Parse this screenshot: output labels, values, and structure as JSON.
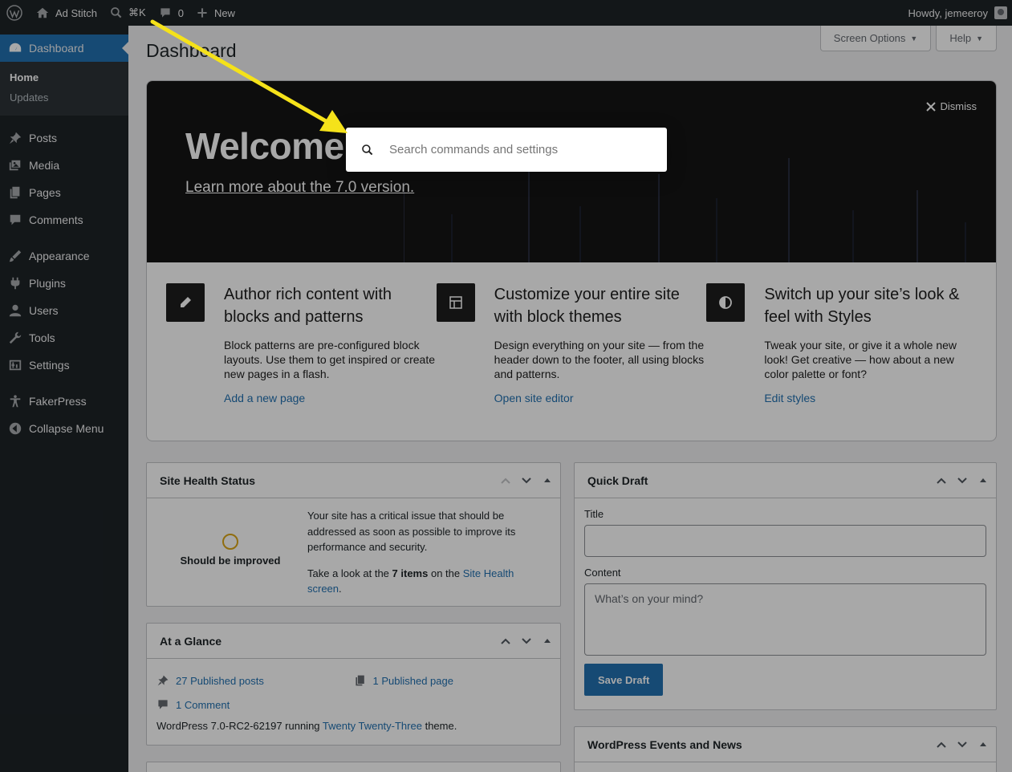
{
  "adminbar": {
    "site_name": "Ad Stitch",
    "shortcut": "⌘K",
    "comments_count": "0",
    "new_label": "New",
    "greeting": "Howdy, jemeeroy"
  },
  "sidebar": {
    "dashboard": "Dashboard",
    "home": "Home",
    "updates": "Updates",
    "items": [
      {
        "label": "Posts",
        "icon": "pushpin-icon"
      },
      {
        "label": "Media",
        "icon": "media-icon"
      },
      {
        "label": "Pages",
        "icon": "pages-icon"
      },
      {
        "label": "Comments",
        "icon": "comment-icon"
      },
      {
        "label": "Appearance",
        "icon": "brush-icon"
      },
      {
        "label": "Plugins",
        "icon": "plug-icon"
      },
      {
        "label": "Users",
        "icon": "user-icon"
      },
      {
        "label": "Tools",
        "icon": "wrench-icon"
      },
      {
        "label": "Settings",
        "icon": "settings-icon"
      },
      {
        "label": "FakerPress",
        "icon": "accessibility-icon"
      },
      {
        "label": "Collapse Menu",
        "icon": "collapse-icon"
      }
    ]
  },
  "header": {
    "screen_options": "Screen Options",
    "help": "Help",
    "page_title": "Dashboard"
  },
  "welcome": {
    "title": "Welcome",
    "link": "Learn more about the 7.0 version.",
    "dismiss": "Dismiss",
    "columns": [
      {
        "icon": "edit-icon",
        "title": "Author rich content with blocks and patterns",
        "text": "Block patterns are pre-configured block layouts. Use them to get inspired or create new pages in a flash.",
        "link": "Add a new page"
      },
      {
        "icon": "layout-icon",
        "title": "Customize your entire site with block themes",
        "text": "Design everything on your site — from the header down to the footer, all using blocks and patterns.",
        "link": "Open site editor"
      },
      {
        "icon": "styles-icon",
        "title": "Switch up your site’s look & feel with Styles",
        "text": "Tweak your site, or give it a whole new look! Get creative — how about a new color palette or font?",
        "link": "Edit styles"
      }
    ]
  },
  "command_palette": {
    "placeholder": "Search commands and settings"
  },
  "site_health": {
    "title": "Site Health Status",
    "status": "Should be improved",
    "message": "Your site has a critical issue that should be addressed as soon as possible to improve its performance and security.",
    "take_look_prefix": "Take a look at the",
    "items_count": "7 items",
    "on_the": "on the",
    "link": "Site Health screen",
    "period": "."
  },
  "at_a_glance": {
    "title": "At a Glance",
    "posts": "27 Published posts",
    "page": "1 Published page",
    "comment": "1 Comment",
    "footer_prefix": "WordPress 7.0-RC2-62197 running",
    "theme": "Twenty Twenty-Three",
    "footer_suffix": "theme."
  },
  "quick_draft": {
    "title": "Quick Draft",
    "title_label": "Title",
    "content_label": "Content",
    "content_placeholder": "What’s on your mind?",
    "save": "Save Draft"
  },
  "events": {
    "title": "WordPress Events and News"
  },
  "colors": {
    "admin_bar": "#1d2327",
    "accent": "#2271b1",
    "arrow": "#f5e21a",
    "health_warning": "#dba617"
  }
}
